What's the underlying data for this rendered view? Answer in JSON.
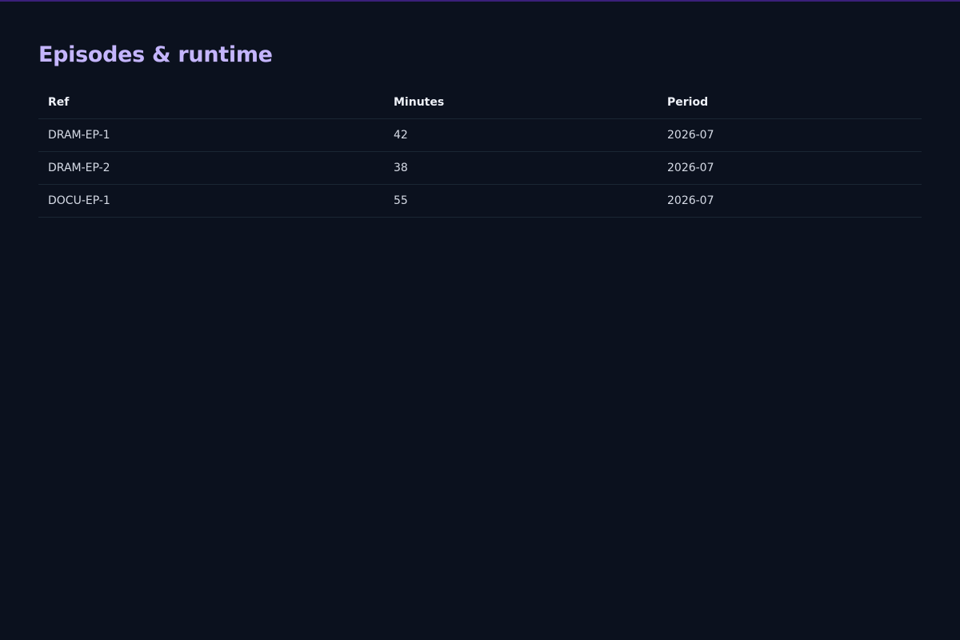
{
  "colors": {
    "background": "#0b111e",
    "title": "#c4b5fd",
    "accent_bar": "#3b1f7a",
    "row_divider": "#1a2634"
  },
  "page": {
    "title": "Episodes & runtime"
  },
  "table": {
    "headers": [
      "Ref",
      "Minutes",
      "Period"
    ],
    "rows": [
      [
        "DRAM-EP-1",
        "42",
        "2026-07"
      ],
      [
        "DRAM-EP-2",
        "38",
        "2026-07"
      ],
      [
        "DOCU-EP-1",
        "55",
        "2026-07"
      ]
    ]
  }
}
